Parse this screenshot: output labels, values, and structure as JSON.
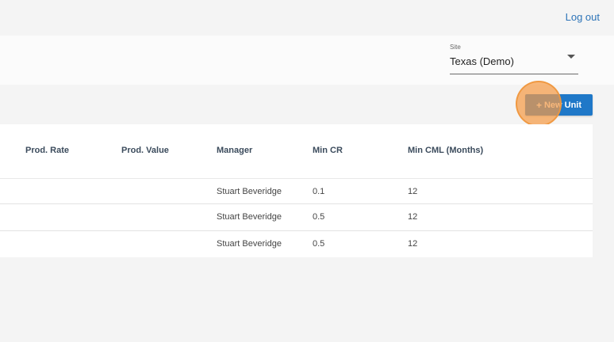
{
  "header": {
    "logout_label": "Log out"
  },
  "site_selector": {
    "label": "Site",
    "value": "Texas (Demo)"
  },
  "toolbar": {
    "new_unit_plus": "+",
    "new_unit_label": "New Unit"
  },
  "table": {
    "columns": [
      "Prod. Rate",
      "Prod. Value",
      "Manager",
      "Min CR",
      "Min CML (Months)"
    ],
    "rows": [
      {
        "prod_rate": "",
        "prod_value": "",
        "manager": "Stuart Beveridge",
        "min_cr": "0.1",
        "min_cml": "12"
      },
      {
        "prod_rate": "",
        "prod_value": "",
        "manager": "Stuart Beveridge",
        "min_cr": "0.5",
        "min_cml": "12"
      },
      {
        "prod_rate": "",
        "prod_value": "",
        "manager": "Stuart Beveridge",
        "min_cr": "0.5",
        "min_cml": "12"
      }
    ]
  },
  "colors": {
    "accent": "#1f78c8",
    "link": "#2d74b8",
    "highlight": "#f59b46"
  }
}
